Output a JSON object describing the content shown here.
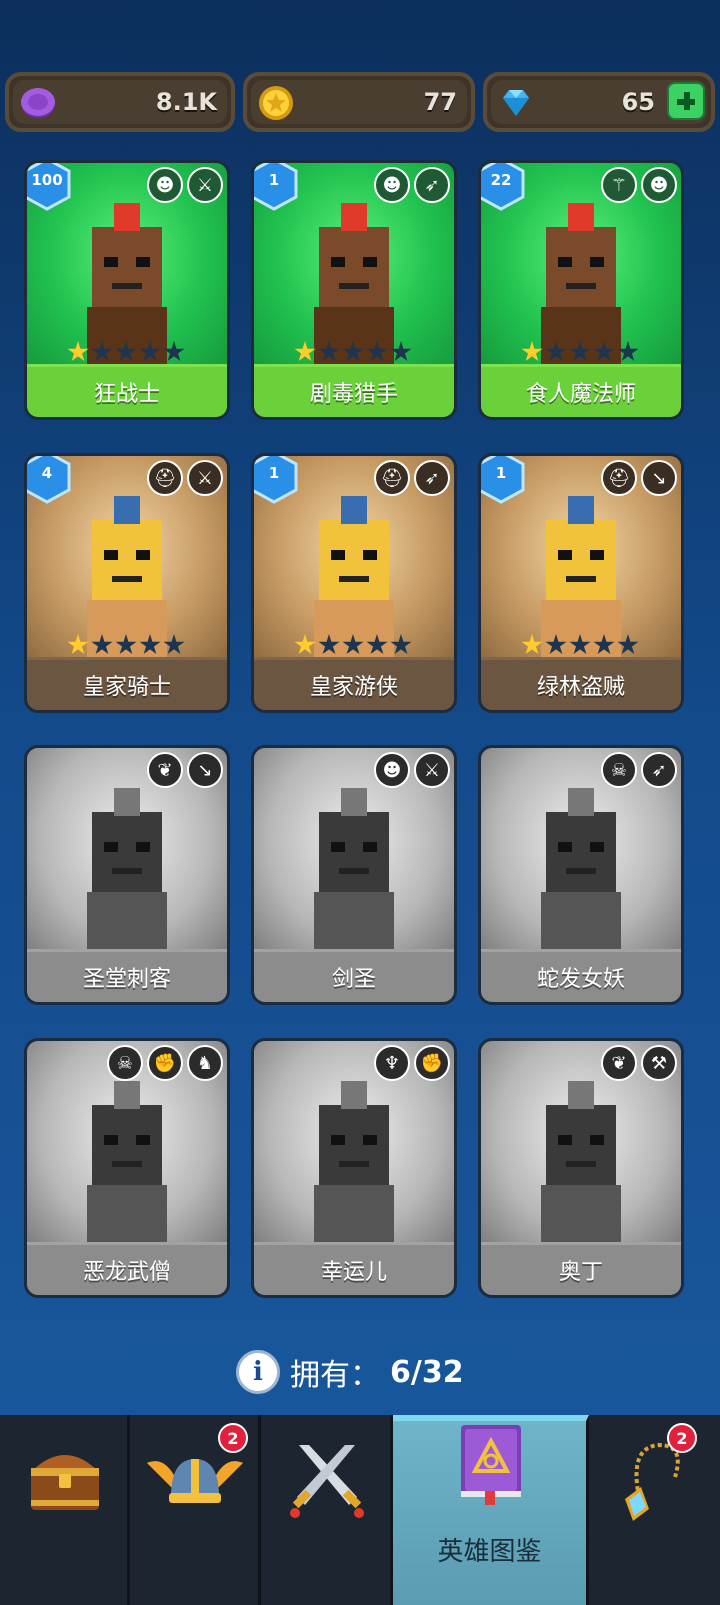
{
  "resources": [
    {
      "name": "purple-coin",
      "value": "8.1K"
    },
    {
      "name": "gold-coin",
      "value": "77"
    },
    {
      "name": "gem",
      "value": "65"
    }
  ],
  "cards": [
    {
      "name": "狂战士",
      "level": "100",
      "stars": 1,
      "owned": true,
      "theme": "green",
      "icons": [
        "monster-class-icon",
        "sword-icon"
      ]
    },
    {
      "name": "剧毒猎手",
      "level": "1",
      "stars": 1,
      "owned": true,
      "theme": "green",
      "icons": [
        "monster-class-icon",
        "bow-icon"
      ]
    },
    {
      "name": "食人魔法师",
      "level": "22",
      "stars": 1,
      "owned": true,
      "theme": "green",
      "icons": [
        "staff-icon",
        "monster-class-icon"
      ]
    },
    {
      "name": "皇家骑士",
      "level": "4",
      "stars": 1,
      "owned": true,
      "theme": "brown",
      "icons": [
        "helmet-icon",
        "sword-icon"
      ]
    },
    {
      "name": "皇家游侠",
      "level": "1",
      "stars": 1,
      "owned": true,
      "theme": "brown",
      "icons": [
        "helmet-icon",
        "bow-icon"
      ]
    },
    {
      "name": "绿林盗贼",
      "level": "1",
      "stars": 1,
      "owned": true,
      "theme": "brown",
      "icons": [
        "helmet-icon",
        "dagger-icon"
      ]
    },
    {
      "name": "圣堂刺客",
      "level": "",
      "stars": 0,
      "owned": false,
      "theme": "grey",
      "icons": [
        "wing-emblem-icon",
        "dagger-icon"
      ]
    },
    {
      "name": "剑圣",
      "level": "",
      "stars": 0,
      "owned": false,
      "theme": "grey",
      "icons": [
        "monster-class-icon",
        "sword-icon"
      ]
    },
    {
      "name": "蛇发女妖",
      "level": "",
      "stars": 0,
      "owned": false,
      "theme": "grey",
      "icons": [
        "skull-icon",
        "bow-icon"
      ]
    },
    {
      "name": "恶龙武僧",
      "level": "",
      "stars": 0,
      "owned": false,
      "theme": "grey",
      "icons": [
        "skull-icon",
        "fist-icon",
        "dragon-icon"
      ]
    },
    {
      "name": "幸运儿",
      "level": "",
      "stars": 0,
      "owned": false,
      "theme": "grey",
      "icons": [
        "elf-icon",
        "fist-icon"
      ]
    },
    {
      "name": "奥丁",
      "level": "",
      "stars": 0,
      "owned": false,
      "theme": "grey",
      "icons": [
        "wing-emblem-icon",
        "hammer-icon"
      ]
    }
  ],
  "owned_label": "拥有：",
  "owned_count": "6/32",
  "tabs": [
    {
      "name": "chest",
      "label": "",
      "badge": ""
    },
    {
      "name": "helmet",
      "label": "",
      "badge": "2"
    },
    {
      "name": "battle",
      "label": "",
      "badge": ""
    },
    {
      "name": "hero-codex",
      "label": "英雄图鉴",
      "badge": "",
      "active": true
    },
    {
      "name": "amulet",
      "label": "",
      "badge": "2"
    }
  ]
}
